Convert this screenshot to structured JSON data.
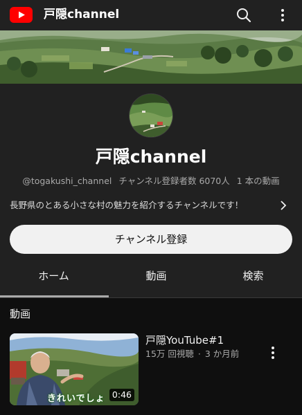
{
  "app": {
    "title": "戸隠channel",
    "icons": {
      "logo": "youtube-logo-icon",
      "search": "search-icon",
      "more": "more-vert-icon"
    },
    "colors": {
      "brand": "#ff0000",
      "background": "#0f0f0f",
      "surface": "#212121"
    }
  },
  "channel": {
    "name": "戸隠channel",
    "handle": "@togakushi_channel",
    "subscribers": "チャンネル登録者数 6070人",
    "video_count": "1 本の動画",
    "description": "長野県のとある小さな村の魅力を紹介するチャンネルです！",
    "subscribe_label": "チャンネル登録"
  },
  "tabs": [
    {
      "label": "ホーム",
      "selected": true
    },
    {
      "label": "動画",
      "selected": false
    },
    {
      "label": "検索",
      "selected": false
    }
  ],
  "videos_section": {
    "title": "動画",
    "items": [
      {
        "title": "戸隠YouTube#1",
        "views": "15万 回視聴",
        "separator": "·",
        "age": "3 か月前",
        "duration": "0:46",
        "thumbnail_caption": "きれいでしょ"
      }
    ]
  }
}
